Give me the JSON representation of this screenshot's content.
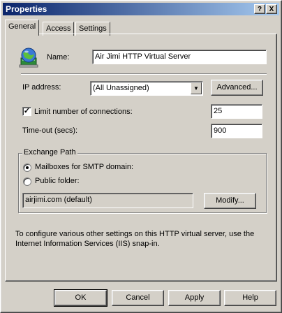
{
  "window": {
    "title": "Properties"
  },
  "titlebar": {
    "help_label": "?",
    "close_label": "X"
  },
  "tabs": [
    {
      "label": "General"
    },
    {
      "label": "Access"
    },
    {
      "label": "Settings"
    }
  ],
  "general": {
    "name_label": "Name:",
    "name_value": "Air Jimi HTTP Virtual Server",
    "ip_label": "IP address:",
    "ip_value": "(All Unassigned)",
    "advanced_label": "Advanced...",
    "limit_label": "Limit number of connections:",
    "limit_value": "25",
    "timeout_label": "Time-out (secs):",
    "timeout_value": "900",
    "exchange_path": {
      "title": "Exchange Path",
      "mailboxes_label": "Mailboxes for SMTP domain:",
      "public_folder_label": "Public folder:",
      "domain_value": "airjimi.com (default)",
      "modify_label": "Modify..."
    },
    "info_text": "To configure various other settings on this HTTP virtual server, use the Internet Information Services (IIS) snap-in."
  },
  "buttons": {
    "ok": "OK",
    "cancel": "Cancel",
    "apply": "Apply",
    "help": "Help"
  },
  "icons": {
    "server": "globe-server-icon",
    "dropdown": "chevron-down-icon"
  }
}
